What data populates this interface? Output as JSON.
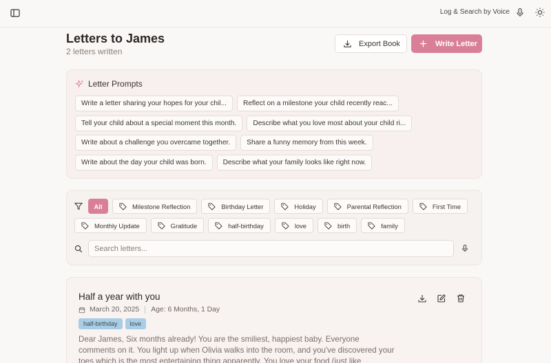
{
  "topbar": {
    "voice_label": "Log & Search by Voice"
  },
  "header": {
    "title": "Letters to James",
    "subtitle": "2 letters written",
    "export_label": "Export Book",
    "write_label": "Write Letter"
  },
  "prompts": {
    "heading": "Letter Prompts",
    "items": [
      "Write a letter sharing your hopes for your chil...",
      "Reflect on a milestone your child recently reac...",
      "Tell your child about a special moment this month.",
      "Describe what you love most about your child ri...",
      "Write about a challenge you overcame together.",
      "Share a funny memory from this week.",
      "Write about the day your child was born.",
      "Describe what your family looks like right now."
    ]
  },
  "filters": {
    "all_label": "All",
    "tags": [
      "Milestone Reflection",
      "Birthday Letter",
      "Holiday",
      "Parental Reflection",
      "First Time",
      "Monthly Update",
      "Gratitude",
      "half-birthday",
      "love",
      "birth",
      "family"
    ],
    "search_placeholder": "Search letters..."
  },
  "letter": {
    "title": "Half a year with you",
    "date": "March 20, 2025",
    "age": "Age: 6 Months, 1 Day",
    "tags": [
      "half-birthday",
      "love"
    ],
    "body": "Dear James, Six months already! You are the smiliest, happiest baby. Everyone comments on it. You light up when Olivia walks into the room, and you've discovered your toes which is the most entertaining thing apparently. You love your food (just like"
  },
  "colors": {
    "accent": "#d98098",
    "tag_blue": "#a9cde4",
    "background": "#faf8f6"
  }
}
